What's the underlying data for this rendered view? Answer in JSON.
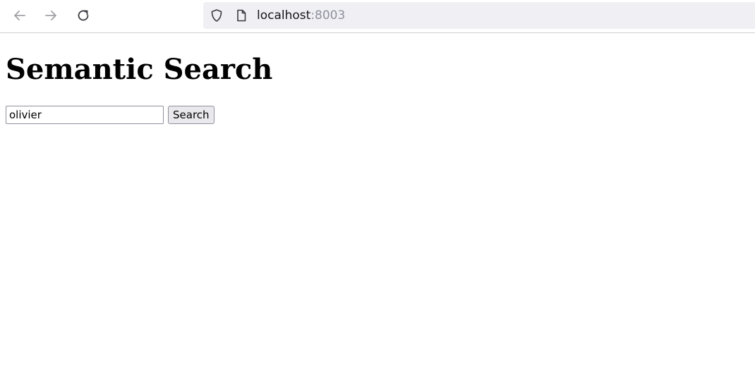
{
  "browser": {
    "url_host": "localhost",
    "url_port": ":8003",
    "icons": {
      "back": "arrow-left-icon",
      "forward": "arrow-right-icon",
      "reload": "reload-icon",
      "shield": "shield-icon",
      "page": "page-icon"
    }
  },
  "page": {
    "title": "Semantic Search",
    "search": {
      "value": "olivier",
      "button_label": "Search"
    }
  }
}
